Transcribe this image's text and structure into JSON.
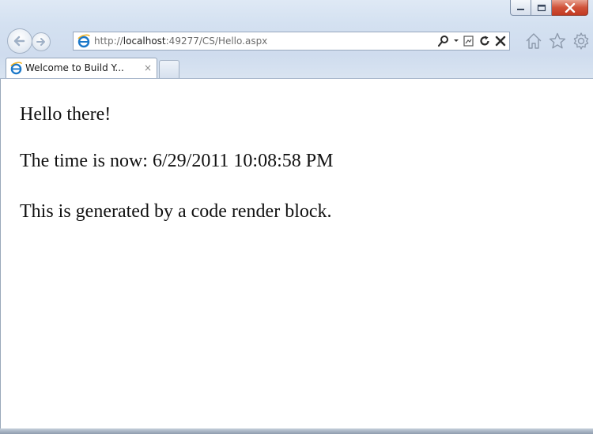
{
  "browser": {
    "window_controls": {
      "minimize_label": "",
      "maximize_label": "",
      "close_label": ""
    },
    "address_bar": {
      "url_prefix": "http://",
      "url_host": "localhost",
      "url_rest": ":49277/CS/Hello.aspx"
    },
    "tab": {
      "title": "Welcome to Build Y...",
      "close_glyph": "×"
    },
    "icons": {
      "back": "back-arrow-icon",
      "forward": "forward-arrow-icon",
      "site": "internet-explorer-icon",
      "search": "search-icon",
      "compatibility": "compatibility-view-icon",
      "refresh": "refresh-icon",
      "stop": "stop-icon",
      "home": "home-icon",
      "favorites": "favorites-star-icon",
      "tools": "tools-gear-icon"
    },
    "colors": {
      "close_button": "#c9452d",
      "ie_logo": "#1b78c9"
    }
  },
  "page": {
    "greeting": "Hello there!",
    "time_prefix": "The time is now:",
    "time_value": "6/29/2011 10:08:58 PM",
    "footer_line": "This is generated by a code render block."
  }
}
